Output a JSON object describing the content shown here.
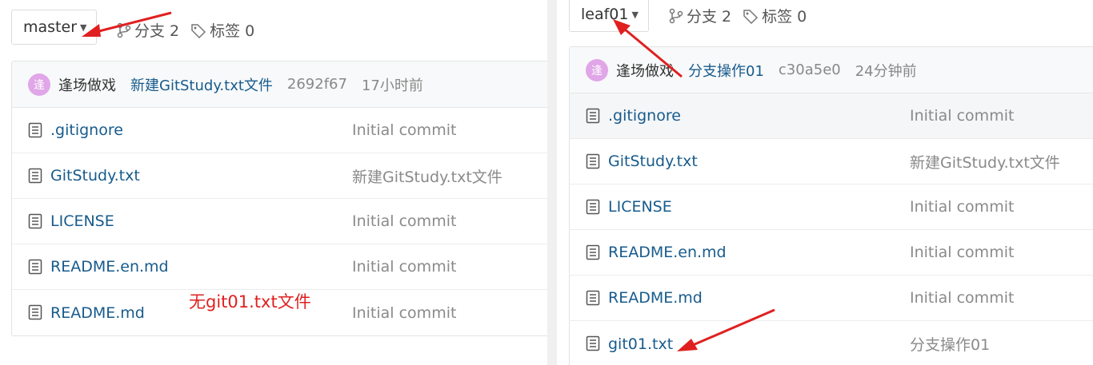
{
  "left": {
    "branch_label": "master",
    "branches_text": "分支 2",
    "tags_text": "标签 0",
    "commit": {
      "avatar_char": "逢",
      "author": "逢场做戏",
      "message": "新建GitStudy.txt文件",
      "sha": "2692f67",
      "time": "17小时前"
    },
    "files": [
      {
        "name": ".gitignore",
        "commit": "Initial commit"
      },
      {
        "name": "GitStudy.txt",
        "commit": "新建GitStudy.txt文件"
      },
      {
        "name": "LICENSE",
        "commit": "Initial commit"
      },
      {
        "name": "README.en.md",
        "commit": "Initial commit"
      },
      {
        "name": "README.md",
        "commit": "Initial commit"
      }
    ],
    "note": "无git01.txt文件"
  },
  "right": {
    "branch_label": "leaf01",
    "branches_text": "分支 2",
    "tags_text": "标签 0",
    "commit": {
      "avatar_char": "逢",
      "author": "逢场做戏",
      "message": "分支操作01",
      "sha": "c30a5e0",
      "time": "24分钟前"
    },
    "files": [
      {
        "name": ".gitignore",
        "commit": "Initial commit"
      },
      {
        "name": "GitStudy.txt",
        "commit": "新建GitStudy.txt文件"
      },
      {
        "name": "LICENSE",
        "commit": "Initial commit"
      },
      {
        "name": "README.en.md",
        "commit": "Initial commit"
      },
      {
        "name": "README.md",
        "commit": "Initial commit"
      },
      {
        "name": "git01.txt",
        "commit": "分支操作01"
      }
    ]
  },
  "colors": {
    "link": "#175b8c",
    "muted": "#8a8a8a",
    "annotation": "#e02020",
    "avatar": "#e0a6e8"
  },
  "icons": [
    "branch-icon",
    "tag-icon",
    "file-icon",
    "caret-down-icon",
    "annotation-arrow"
  ]
}
